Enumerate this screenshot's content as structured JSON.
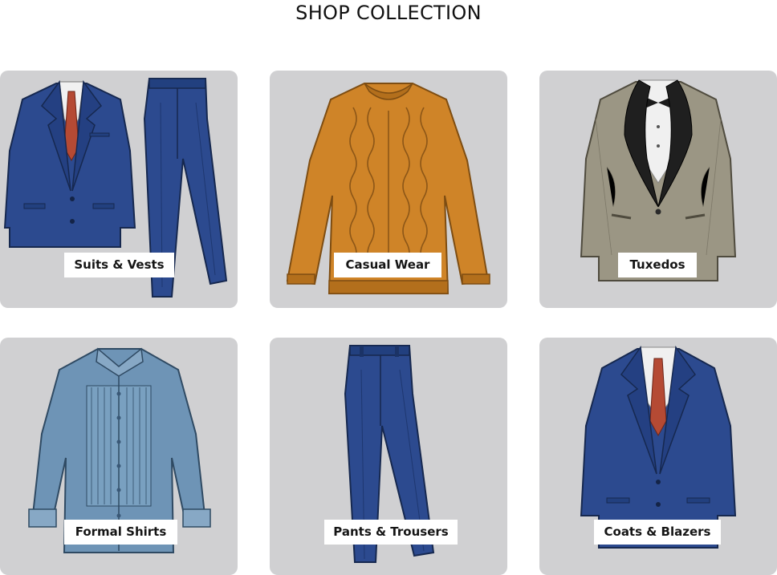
{
  "header": {
    "title": "SHOP COLLECTION"
  },
  "categories": [
    {
      "label": "Suits & Vests",
      "icon": "suit-and-trousers-illustration"
    },
    {
      "label": "Casual Wear",
      "icon": "cable-knit-sweater-illustration"
    },
    {
      "label": "Tuxedos",
      "icon": "tuxedo-jacket-illustration"
    },
    {
      "label": "Formal Shirts",
      "icon": "tuxedo-shirt-illustration"
    },
    {
      "label": "Pants & Trousers",
      "icon": "trousers-illustration"
    },
    {
      "label": "Coats & Blazers",
      "icon": "blazer-illustration"
    }
  ],
  "colors": {
    "card_background": "#d0d0d2",
    "label_background": "#ffffff",
    "navy_suit": "#2c4a8f",
    "sweater_orange": "#cf8428",
    "tuxedo_grey": "#9b9684",
    "shirt_blue": "#6e94b6",
    "tie_red": "#b54a34"
  }
}
